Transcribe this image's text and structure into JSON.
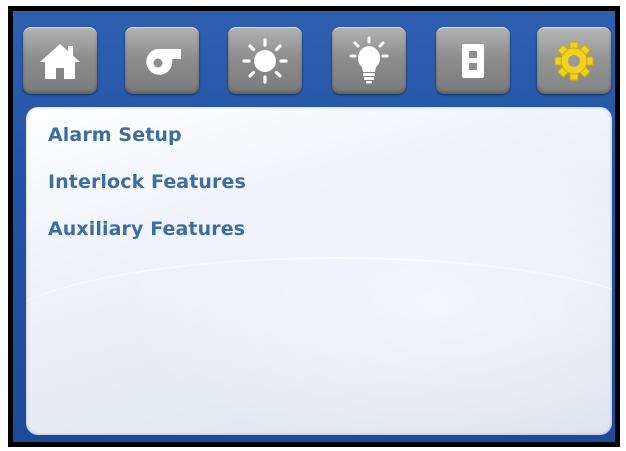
{
  "toolbar": {
    "buttons": [
      {
        "name": "home",
        "icon": "home-icon"
      },
      {
        "name": "fan",
        "icon": "fan-icon"
      },
      {
        "name": "sun",
        "icon": "sun-icon"
      },
      {
        "name": "light",
        "icon": "lightbulb-icon"
      },
      {
        "name": "switch",
        "icon": "switch-icon"
      },
      {
        "name": "settings",
        "icon": "gear-icon",
        "active": true
      }
    ]
  },
  "menu": {
    "items": [
      {
        "label": "Alarm Setup"
      },
      {
        "label": "Interlock Features"
      },
      {
        "label": "Auxiliary Features"
      }
    ]
  },
  "colors": {
    "bezel": "#2253a6",
    "menu_text": "#3c6f9f",
    "gear_accent": "#f2d21c",
    "button_gray": "#8e8e8e"
  }
}
